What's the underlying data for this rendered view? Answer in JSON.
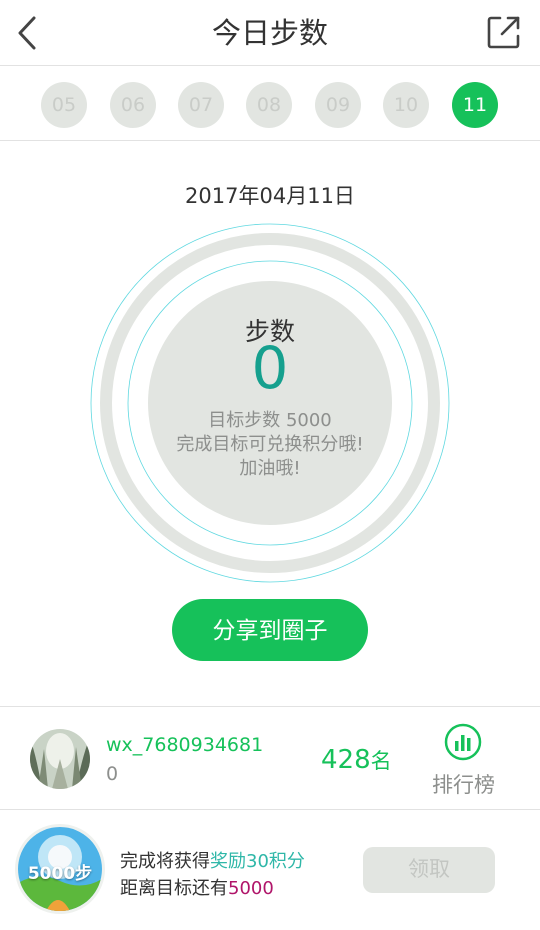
{
  "header": {
    "title": "今日步数",
    "back_icon": "chevron-left-icon",
    "share_icon": "external-share-icon"
  },
  "days": [
    {
      "label": "05",
      "active": false
    },
    {
      "label": "06",
      "active": false
    },
    {
      "label": "07",
      "active": false
    },
    {
      "label": "08",
      "active": false
    },
    {
      "label": "09",
      "active": false
    },
    {
      "label": "10",
      "active": false
    },
    {
      "label": "11",
      "active": true
    }
  ],
  "date": "2017年04月11日",
  "progress": {
    "label": "步数",
    "value": "0",
    "goal_text": "目标步数 5000",
    "hint1": "完成目标可兑换积分哦!",
    "hint2": "加油哦!"
  },
  "share_button": "分享到圈子",
  "rank": {
    "username": "wx_7680934681",
    "steps": "0",
    "position": "428",
    "position_unit": "名",
    "leaderboard_label": "排行榜"
  },
  "reward": {
    "badge": "5000步",
    "line1_prefix": "完成将获得",
    "line1_highlight": "奖励30积分",
    "line2_prefix": "距离目标还有",
    "line2_highlight": "5000",
    "claim_button": "领取"
  },
  "colors": {
    "accent": "#16c15a",
    "teal": "#15a08e",
    "muted": "#e2e5e1",
    "magenta": "#b0156a"
  }
}
